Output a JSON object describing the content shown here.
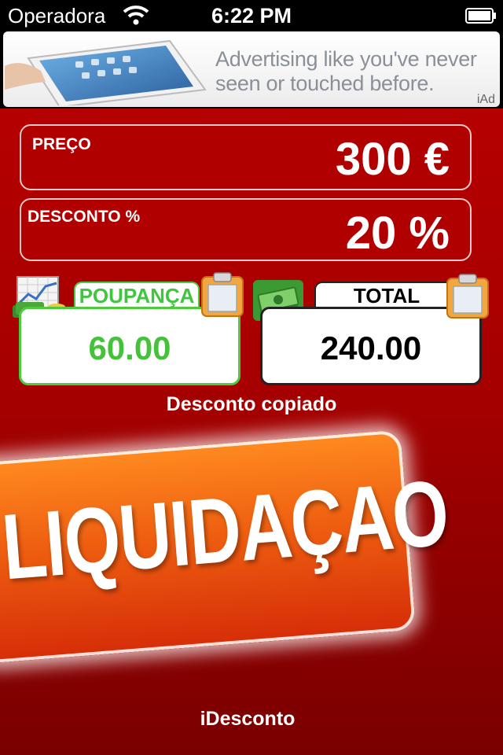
{
  "status_bar": {
    "carrier": "Operadora",
    "time": "6:22 PM",
    "icons": [
      "wifi-icon",
      "battery-icon"
    ]
  },
  "ad_banner": {
    "headline": "Advertising like you've never seen or touched before.",
    "brand": "iAd",
    "image": "tablet-with-hand"
  },
  "price": {
    "label": "PREÇO",
    "value": "300 €"
  },
  "discount": {
    "label": "DESCONTO %",
    "value": "20 %"
  },
  "savings": {
    "label": "POUPANÇA",
    "value": "60.00",
    "icon": "chart-coins-icon",
    "copy_icon": "clipboard-icon",
    "color": "#44c33a"
  },
  "total": {
    "label": "TOTAL",
    "value": "240.00",
    "icon": "money-stack-icon",
    "copy_icon": "clipboard-icon"
  },
  "copy_status": "Desconto copiado",
  "sale_banner": {
    "text": "LIQUIDAÇAO"
  },
  "app_name": "iDesconto",
  "colors": {
    "background_red": "#a50000",
    "accent_orange": "#ee5e10",
    "savings_green": "#44c33a"
  }
}
